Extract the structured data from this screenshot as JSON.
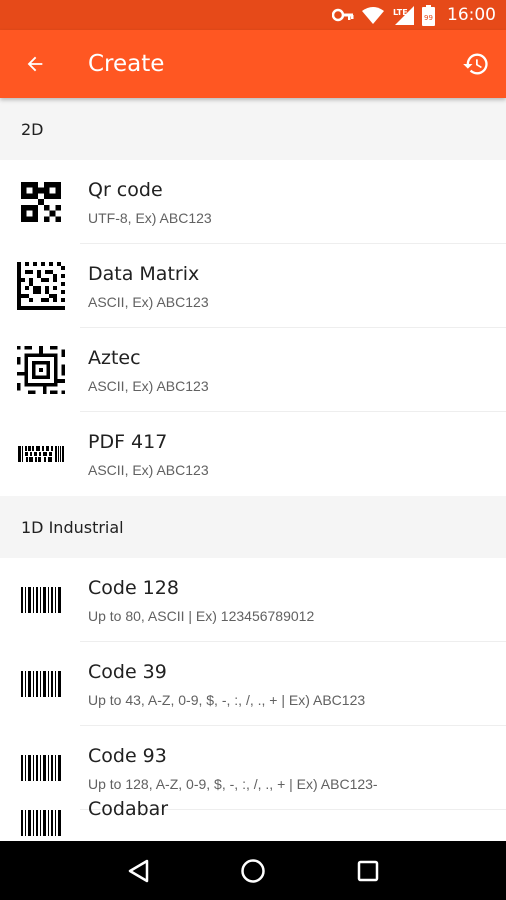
{
  "status_bar": {
    "time": "16:00",
    "network": "LTE",
    "battery": "99"
  },
  "app_bar": {
    "title": "Create"
  },
  "sections": [
    {
      "header": "2D",
      "items": [
        {
          "name": "Qr code",
          "desc": "UTF-8, Ex) ABC123",
          "icon": "qr-code-icon"
        },
        {
          "name": "Data Matrix",
          "desc": "ASCII, Ex) ABC123",
          "icon": "data-matrix-icon"
        },
        {
          "name": "Aztec",
          "desc": "ASCII, Ex) ABC123",
          "icon": "aztec-icon"
        },
        {
          "name": "PDF 417",
          "desc": "ASCII, Ex) ABC123",
          "icon": "pdf417-icon"
        }
      ]
    },
    {
      "header": "1D Industrial",
      "items": [
        {
          "name": "Code 128",
          "desc": "Up to 80, ASCII | Ex) 123456789012",
          "icon": "barcode-icon"
        },
        {
          "name": "Code 39",
          "desc": "Up to 43, A-Z, 0-9, $, -, :, /, ., + | Ex) ABC123",
          "icon": "barcode-icon"
        },
        {
          "name": "Code 93",
          "desc": "Up to 128, A-Z, 0-9, $, -, :, /, ., + | Ex) ABC123-",
          "icon": "barcode-icon"
        },
        {
          "name": "Codabar",
          "desc": "",
          "icon": "barcode-icon"
        }
      ]
    }
  ],
  "colors": {
    "primary": "#ff5722",
    "primary_dark": "#e64a19"
  }
}
